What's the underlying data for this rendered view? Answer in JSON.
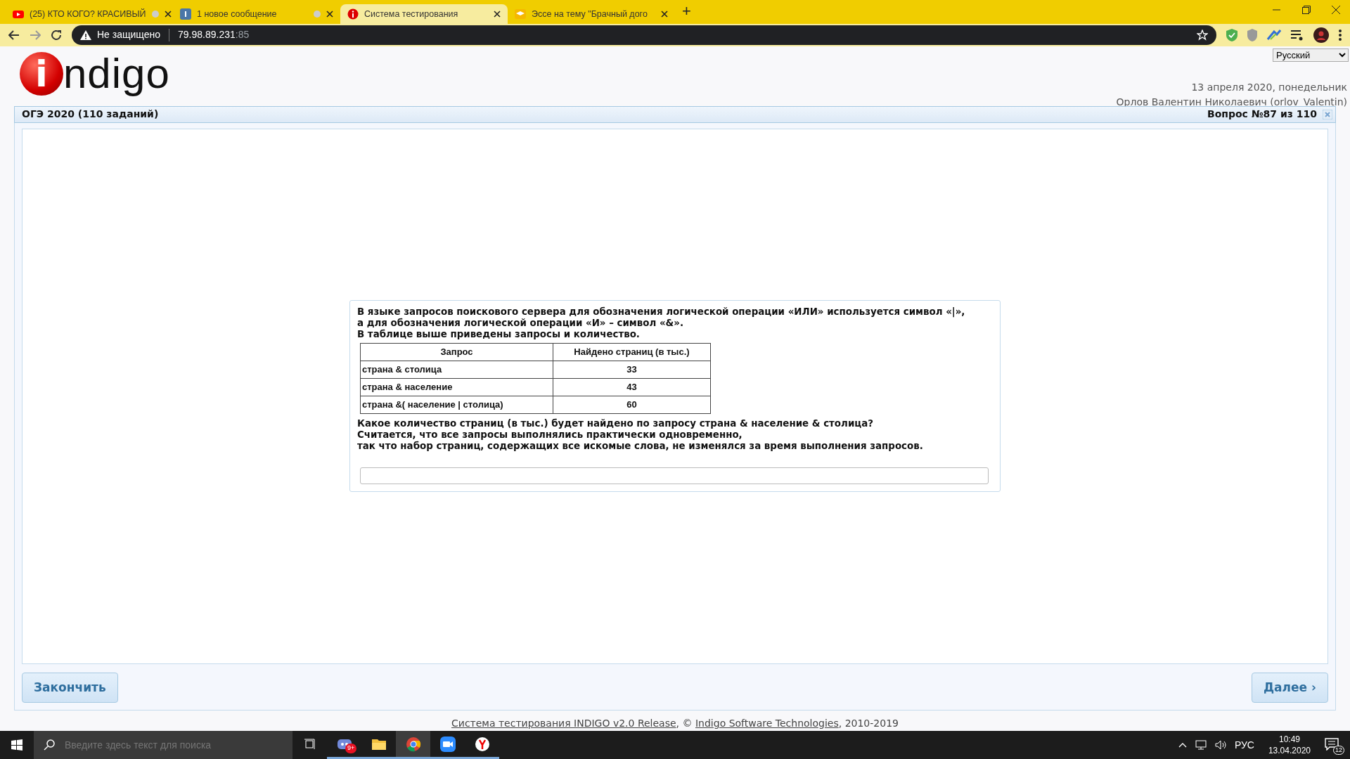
{
  "browser": {
    "tabs": [
      {
        "title": "(25) КТО КОГО? КРАСИВЫЙ",
        "selected": false,
        "indicator": true
      },
      {
        "title": "1 новое сообщение",
        "selected": false,
        "indicator": true
      },
      {
        "title": "Система тестирования",
        "selected": true,
        "indicator": false
      },
      {
        "title": "Эссе на тему \"Брачный дого",
        "selected": false,
        "indicator": false
      }
    ],
    "new_tab": "+",
    "security": "Не защищено",
    "url_host": "79.98.89.231",
    "url_port": ":85"
  },
  "page": {
    "logo": {
      "letter": "i",
      "text": "ndigo"
    },
    "language": "Русский",
    "date": "13 апреля 2020, понедельник",
    "user": "Орлов Валентин Николаевич (orlov_Valentin)",
    "test_title": "ОГЭ 2020 (110 заданий)",
    "question_counter": "Вопрос №87 из 110",
    "question": {
      "intro": [
        "В языке запросов поискового сервера для обозначения логической операции «ИЛИ» используется символ «|»,",
        "а для обозначения логической операции «И» – символ «&».",
        "В таблице выше приведены запросы и количество."
      ],
      "table": {
        "columns": [
          "Запрос",
          "Найдено страниц (в тыс.)"
        ],
        "rows": [
          [
            "страна & столица",
            "33"
          ],
          [
            "страна & население",
            "43"
          ],
          [
            "страна &( население | столица)",
            "60"
          ]
        ]
      },
      "outro": [
        "Какое количество страниц (в тыс.) будет найдено по запросу страна & население & столица?",
        "Считается, что все запросы выполнялись практически одновременно,",
        "так что набор страниц, содержащих все искомые слова, не изменялся за время выполнения запросов."
      ]
    },
    "buttons": {
      "finish": "Закончить",
      "next": "Далее ›"
    },
    "footer": [
      {
        "text": "Система тестирования INDIGO v2.0 Release",
        "link": true
      },
      {
        "text": ", © ",
        "link": false
      },
      {
        "text": "Indigo Software Technologies",
        "link": true
      },
      {
        "text": ", 2010-2019",
        "link": false
      }
    ]
  },
  "taskbar": {
    "search_placeholder": "Введите здесь текст для поиска",
    "apps": [
      {
        "badge": "9+",
        "selected": false
      },
      {
        "selected": false
      },
      {
        "selected": true
      },
      {
        "selected": false
      },
      {
        "selected": false
      }
    ],
    "language": "РУС",
    "time": "10:49",
    "date": "13.04.2020",
    "notifications": "12"
  }
}
